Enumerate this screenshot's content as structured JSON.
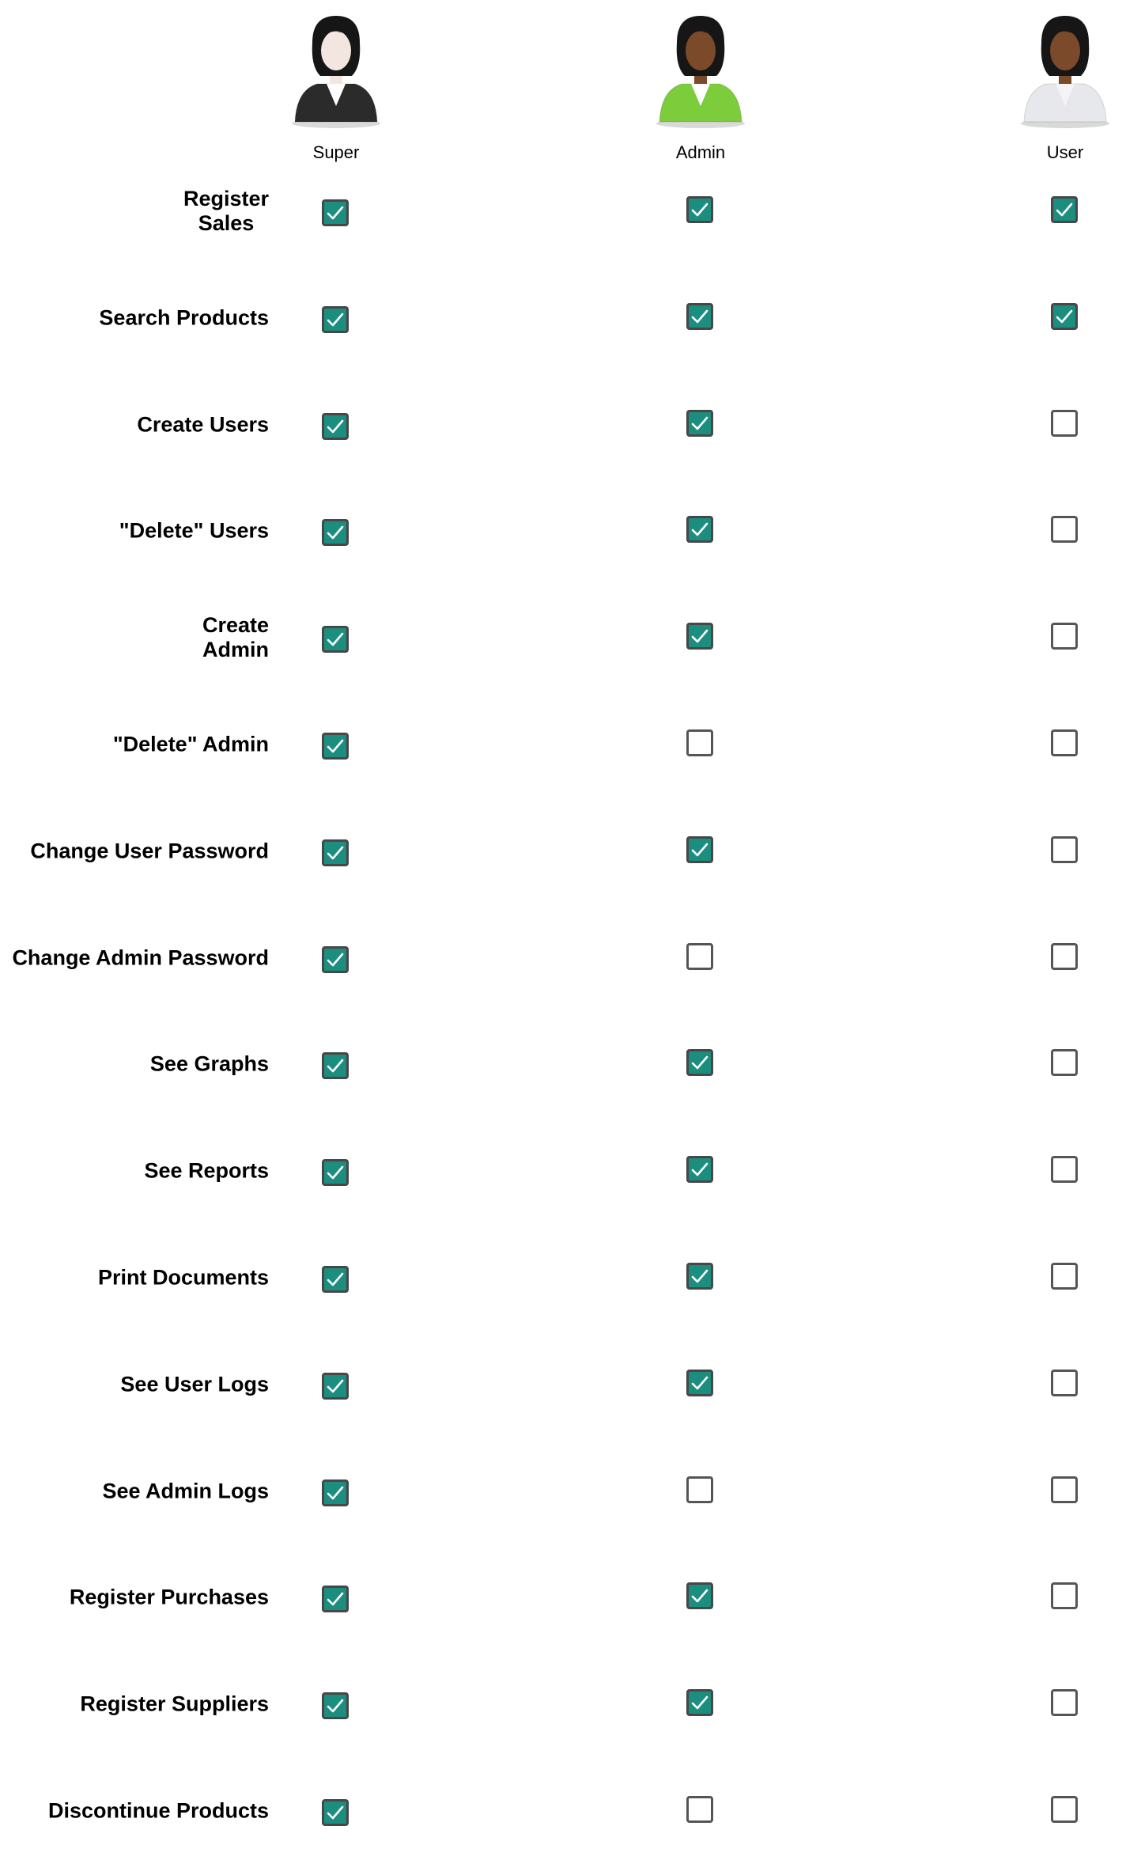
{
  "roles": [
    {
      "name": "Super",
      "icon": "woman-black-suit-avatar-icon",
      "suit_color": "#2b2b2b"
    },
    {
      "name": "Admin",
      "icon": "woman-green-suit-avatar-icon",
      "suit_color": "#7ccc3c"
    },
    {
      "name": "User",
      "icon": "woman-white-shirt-avatar-icon",
      "suit_color": "#e7e8ec"
    }
  ],
  "permissions": [
    {
      "label": "Register\nSales",
      "super": true,
      "admin": true,
      "user": true
    },
    {
      "label": "Search Products",
      "super": true,
      "admin": true,
      "user": true
    },
    {
      "label": "Create Users",
      "super": true,
      "admin": true,
      "user": false
    },
    {
      "label": "\"Delete\" Users",
      "super": true,
      "admin": true,
      "user": false
    },
    {
      "label": "Create\nAdmin",
      "super": true,
      "admin": true,
      "user": false
    },
    {
      "label": "\"Delete\" Admin",
      "super": true,
      "admin": false,
      "user": false
    },
    {
      "label": "Change User Password",
      "super": true,
      "admin": true,
      "user": false
    },
    {
      "label": "Change Admin Password",
      "super": true,
      "admin": false,
      "user": false
    },
    {
      "label": "See Graphs",
      "super": true,
      "admin": true,
      "user": false
    },
    {
      "label": "See Reports",
      "super": true,
      "admin": true,
      "user": false
    },
    {
      "label": "Print Documents",
      "super": true,
      "admin": true,
      "user": false
    },
    {
      "label": "See User Logs",
      "super": true,
      "admin": true,
      "user": false
    },
    {
      "label": "See Admin Logs",
      "super": true,
      "admin": false,
      "user": false
    },
    {
      "label": "Register Purchases",
      "super": true,
      "admin": true,
      "user": false
    },
    {
      "label": "Register Suppliers",
      "super": true,
      "admin": true,
      "user": false
    },
    {
      "label": "Discontinue Products",
      "super": true,
      "admin": false,
      "user": false
    }
  ],
  "colors": {
    "checked_fill": "#1c8e7f",
    "checkbox_border": "#474747"
  },
  "icons": {
    "checked": "checkmark-icon"
  }
}
